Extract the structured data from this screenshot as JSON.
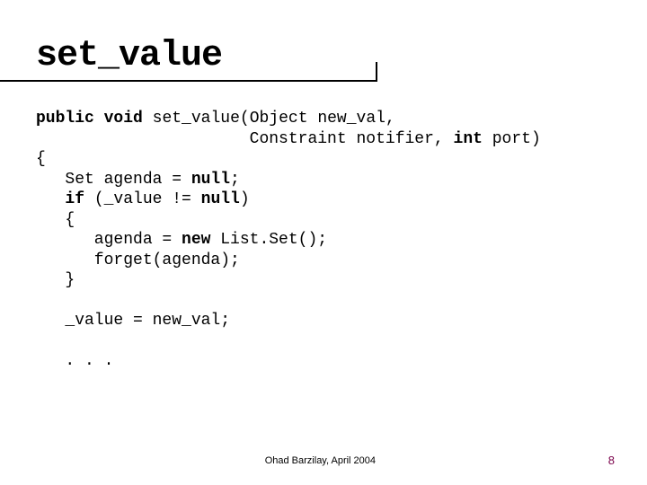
{
  "title": "set_value",
  "code": {
    "return_type": "void",
    "access": "public",
    "fn_name": "set_value",
    "param1_type": "Object",
    "param1_name": "new_val",
    "param2_type": "Constraint",
    "param2_name": "notifier",
    "param3_type": "int",
    "param3_name": "port",
    "line_open": "{",
    "agenda_decl_pre": "   Set agenda = ",
    "null1": "null",
    "semi1": ";",
    "if_pre": "   ",
    "if_kw": "if",
    "if_cond_pre": " (_value != ",
    "null2": "null",
    "if_cond_post": ")",
    "inner_open": "   {",
    "inner_assign_pre": "      agenda = ",
    "new_kw": "new",
    "inner_assign_post": " List.Set();",
    "forget_line": "      forget(agenda);",
    "inner_close": "   }",
    "assign_line": "   _value = new_val;",
    "ellipsis": "   . . ."
  },
  "footer": {
    "author": "Ohad Barzilay, April 2004",
    "page": "8"
  }
}
